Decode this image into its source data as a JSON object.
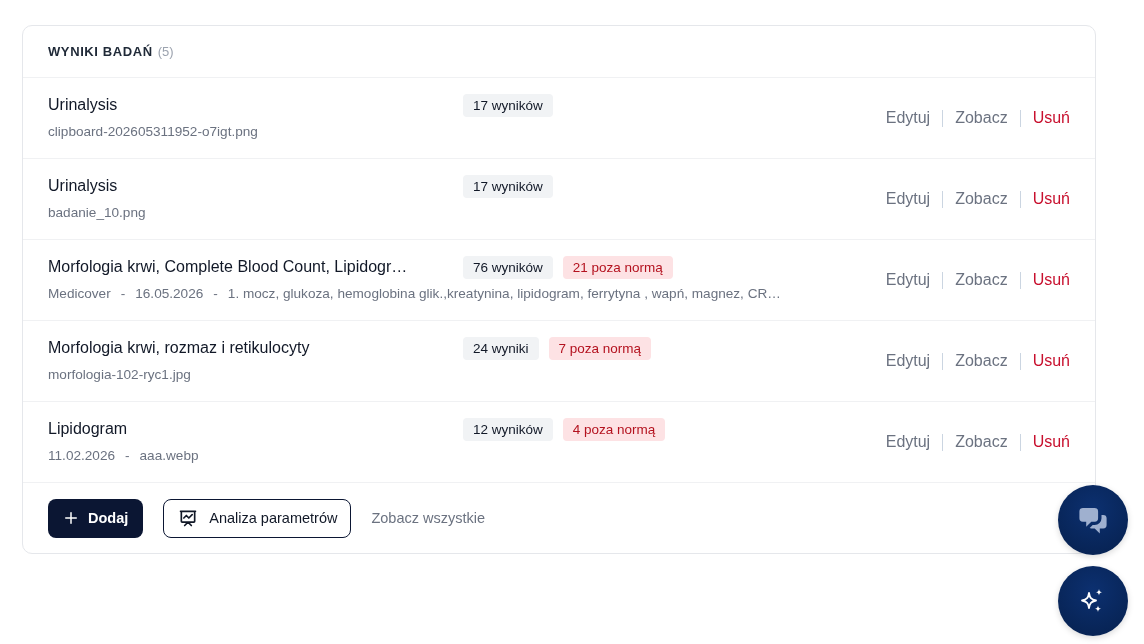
{
  "section": {
    "title": "WYNIKI BADAŃ",
    "count": "(5)"
  },
  "results": [
    {
      "title": "Urinalysis",
      "meta": [
        "clipboard-202605311952-o7igt.png"
      ],
      "badges": [
        {
          "kind": "count",
          "label": "17 wyników"
        }
      ],
      "actions": [
        {
          "kind": "edit",
          "label": "Edytuj"
        },
        {
          "kind": "view",
          "label": "Zobacz"
        },
        {
          "kind": "delete",
          "label": "Usuń"
        }
      ]
    },
    {
      "title": "Urinalysis",
      "meta": [
        "badanie_10.png"
      ],
      "badges": [
        {
          "kind": "count",
          "label": "17 wyników"
        }
      ],
      "actions": [
        {
          "kind": "edit",
          "label": "Edytuj"
        },
        {
          "kind": "view",
          "label": "Zobacz"
        },
        {
          "kind": "delete",
          "label": "Usuń"
        }
      ]
    },
    {
      "title": "Morfologia krwi, Complete Blood Count, Lipidogr…",
      "meta": [
        "Medicover",
        "-",
        "16.05.2026",
        "-",
        "1. mocz, glukoza, hemoglobina glik.,kreatynina, lipidogram, ferrytyna , wapń, magnez, CR…"
      ],
      "badges": [
        {
          "kind": "count",
          "label": "76 wyników"
        },
        {
          "kind": "abnormal",
          "label": "21 poza normą"
        }
      ],
      "actions": [
        {
          "kind": "edit",
          "label": "Edytuj"
        },
        {
          "kind": "view",
          "label": "Zobacz"
        },
        {
          "kind": "delete",
          "label": "Usuń"
        }
      ]
    },
    {
      "title": "Morfologia krwi, rozmaz i retikulocyty",
      "meta": [
        "morfologia-102-ryc1.jpg"
      ],
      "badges": [
        {
          "kind": "count",
          "label": "24 wyniki"
        },
        {
          "kind": "abnormal",
          "label": "7 poza normą"
        }
      ],
      "actions": [
        {
          "kind": "edit",
          "label": "Edytuj"
        },
        {
          "kind": "view",
          "label": "Zobacz"
        },
        {
          "kind": "delete",
          "label": "Usuń"
        }
      ]
    },
    {
      "title": "Lipidogram",
      "meta": [
        "11.02.2026",
        "-",
        "aaa.webp"
      ],
      "badges": [
        {
          "kind": "count",
          "label": "12 wyników"
        },
        {
          "kind": "abnormal",
          "label": "4 poza normą"
        }
      ],
      "actions": [
        {
          "kind": "edit",
          "label": "Edytuj"
        },
        {
          "kind": "view",
          "label": "Zobacz"
        },
        {
          "kind": "delete",
          "label": "Usuń"
        }
      ]
    }
  ],
  "footer": {
    "add_button": "Dodaj",
    "analysis_button": "Analiza parametrów",
    "view_all_link": "Zobacz wszystkie"
  },
  "floating_buttons": [
    {
      "kind": "chat"
    },
    {
      "kind": "assistant"
    }
  ]
}
